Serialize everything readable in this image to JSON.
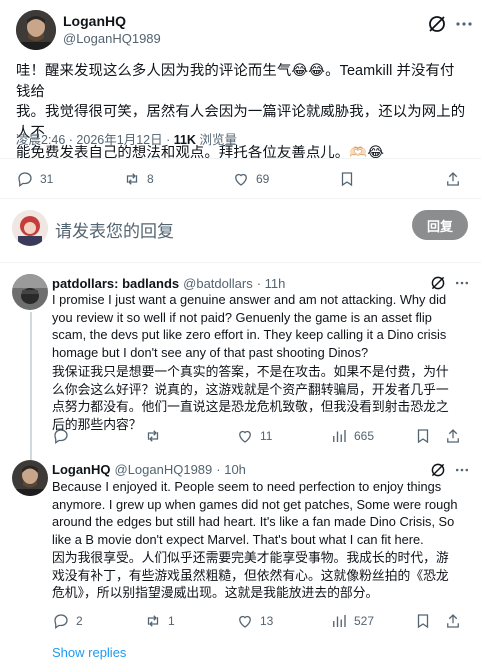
{
  "main_tweet": {
    "author_name": "LoganHQ",
    "author_handle": "@LoganHQ1989",
    "text_line1": "哇！醒来发现这么多人因为我的评论而生气😂😂。Teamkill 并没有付钱给",
    "text_line2": "我。我觉得很可笑，居然有人会因为一篇评论就威胁我，还以为网上的人不",
    "text_line3": "能免费发表自己的想法和观点。拜托各位友善点儿。🫶🏻😂",
    "time": "凌晨2:46 · 2026年1月12日 · ",
    "views_count": "11K",
    "views_label": " 浏览量",
    "stats": {
      "replies": "31",
      "reposts": "8",
      "likes": "69"
    }
  },
  "compose": {
    "placeholder": "请发表您的回复",
    "button_label": "回复"
  },
  "replies": [
    {
      "name": "patdollars: badlands",
      "handle": "@batdollars",
      "time": "· 11h",
      "text_en": "I promise I just want a genuine answer and am not attacking. Why did you review it so well if not paid? Genuenly the game is an asset flip scam, the devs put like zero effort in. They keep calling it a Dino crisis homage but I don't see any of that past shooting Dinos?",
      "text_zh": "我保证我只是想要一个真实的答案，不是在攻击。如果不是付费，为什么你会这么好评？说真的，这游戏就是个资产翻转骗局，开发者几乎一点努力都没有。他们一直说这是恐龙危机致敬，但我没看到射击恐龙之后的那些内容？",
      "stats": {
        "replies": "",
        "reposts": "",
        "likes": "11",
        "views": "665"
      }
    },
    {
      "name": "LoganHQ",
      "handle": "@LoganHQ1989",
      "time": "· 10h",
      "text_en": "Because I enjoyed it. People seem to need perfection to enjoy things anymore. I grew up when games did not get patches, Some were rough around the edges but still had heart. It's like a fan made Dino Crisis, So like a B movie don't expect Marvel. That's bout what I can fit here.",
      "text_zh": "因为我很享受。人们似乎还需要完美才能享受事物。我成长的时代，游戏没有补丁，有些游戏虽然粗糙，但依然有心。这就像粉丝拍的《恐龙危机》，所以别指望漫威出现。这就是我能放进去的部分。",
      "stats": {
        "replies": "2",
        "reposts": "1",
        "likes": "13",
        "views": "527"
      }
    }
  ],
  "show_replies": "Show replies",
  "colors": {
    "accent": "#1d9bf0",
    "muted": "#536471",
    "text": "#0f1419",
    "divider": "#eff3f4",
    "reply_button": "#8c8d8e"
  }
}
